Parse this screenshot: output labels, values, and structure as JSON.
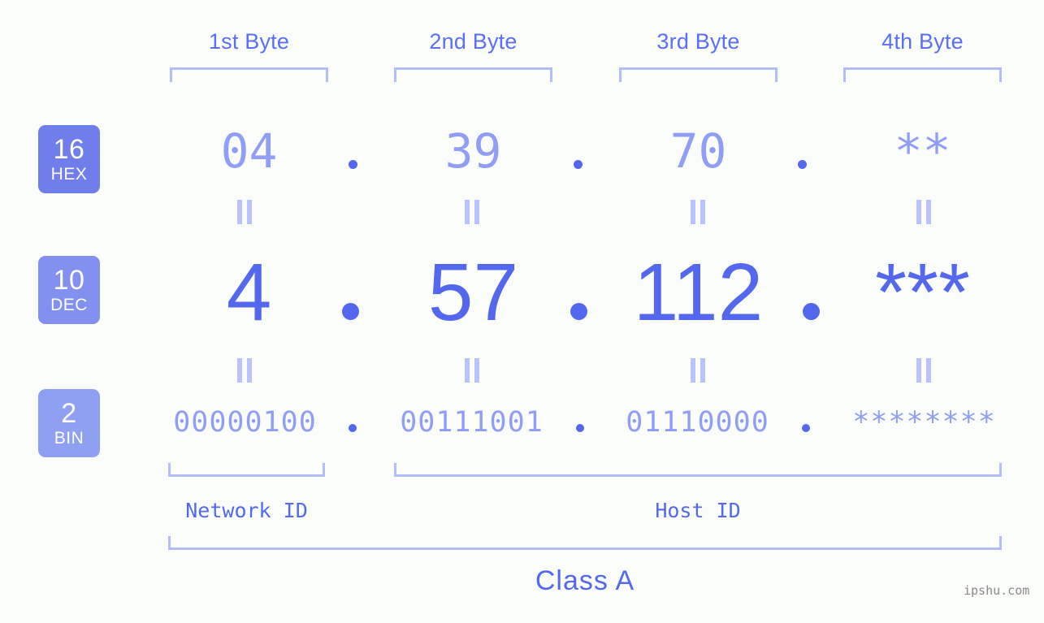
{
  "background_color": "#fbfdfa",
  "accent_color": "#5468ee",
  "accent_light_color": "#919ef5",
  "bracket_color": "#b3bdfb",
  "byte_headers": [
    {
      "label": "1st Byte"
    },
    {
      "label": "2nd Byte"
    },
    {
      "label": "3rd Byte"
    },
    {
      "label": "4th Byte"
    }
  ],
  "rows": {
    "hex": {
      "badge_number": "16",
      "badge_name": "HEX",
      "badge_color": "#6f7eeb",
      "values": [
        "04",
        "39",
        "70",
        "**"
      ],
      "separator": "."
    },
    "dec": {
      "badge_number": "10",
      "badge_name": "DEC",
      "badge_color": "#8290f0",
      "values": [
        "4",
        "57",
        "112",
        "***"
      ],
      "separator": "."
    },
    "bin": {
      "badge_number": "2",
      "badge_name": "BIN",
      "badge_color": "#8fa0f3",
      "values": [
        "00000100",
        "00111001",
        "01110000",
        "********"
      ],
      "separator": "."
    }
  },
  "equality_marks": {
    "symbol": "=",
    "count_per_row": 4
  },
  "sections": [
    {
      "label": "Network ID"
    },
    {
      "label": "Host ID"
    }
  ],
  "class": {
    "label": "Class A"
  },
  "watermark": {
    "text": "ipshu.com"
  }
}
